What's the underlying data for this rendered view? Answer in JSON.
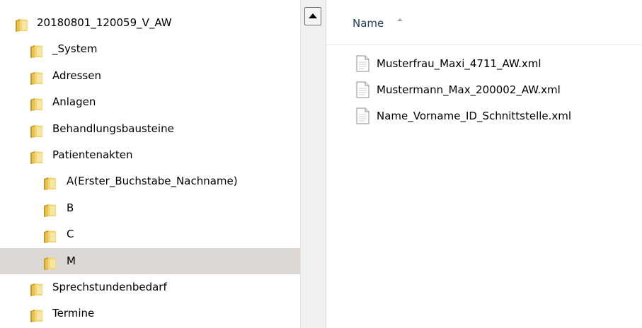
{
  "tree": {
    "items": [
      {
        "label": "20180801_120059_V_AW",
        "level": 0,
        "selected": false
      },
      {
        "label": "_System",
        "level": 1,
        "selected": false
      },
      {
        "label": "Adressen",
        "level": 1,
        "selected": false
      },
      {
        "label": "Anlagen",
        "level": 1,
        "selected": false
      },
      {
        "label": "Behandlungsbausteine",
        "level": 1,
        "selected": false
      },
      {
        "label": "Patientenakten",
        "level": 1,
        "selected": false
      },
      {
        "label": "A(Erster_Buchstabe_Nachname)",
        "level": 2,
        "selected": false
      },
      {
        "label": "B",
        "level": 2,
        "selected": false
      },
      {
        "label": "C",
        "level": 2,
        "selected": false
      },
      {
        "label": "M",
        "level": 2,
        "selected": true
      },
      {
        "label": "Sprechstundenbedarf",
        "level": 1,
        "selected": false
      },
      {
        "label": "Termine",
        "level": 1,
        "selected": false
      }
    ]
  },
  "file_list": {
    "column_header": "Name",
    "files": [
      {
        "name": "Musterfrau_Maxi_4711_AW.xml"
      },
      {
        "name": "Mustermann_Max_200002_AW.xml"
      },
      {
        "name": "Name_Vorname_ID_Schnittstelle.xml"
      }
    ]
  },
  "colors": {
    "selection": "#dcd8d5",
    "folder": "#e8c252",
    "header_text": "#1e395b"
  },
  "icons": {
    "folder": "folder-icon",
    "file": "xml-file-icon",
    "scroll_up": "scroll-up-arrow-icon",
    "sort": "sort-ascending-icon"
  }
}
